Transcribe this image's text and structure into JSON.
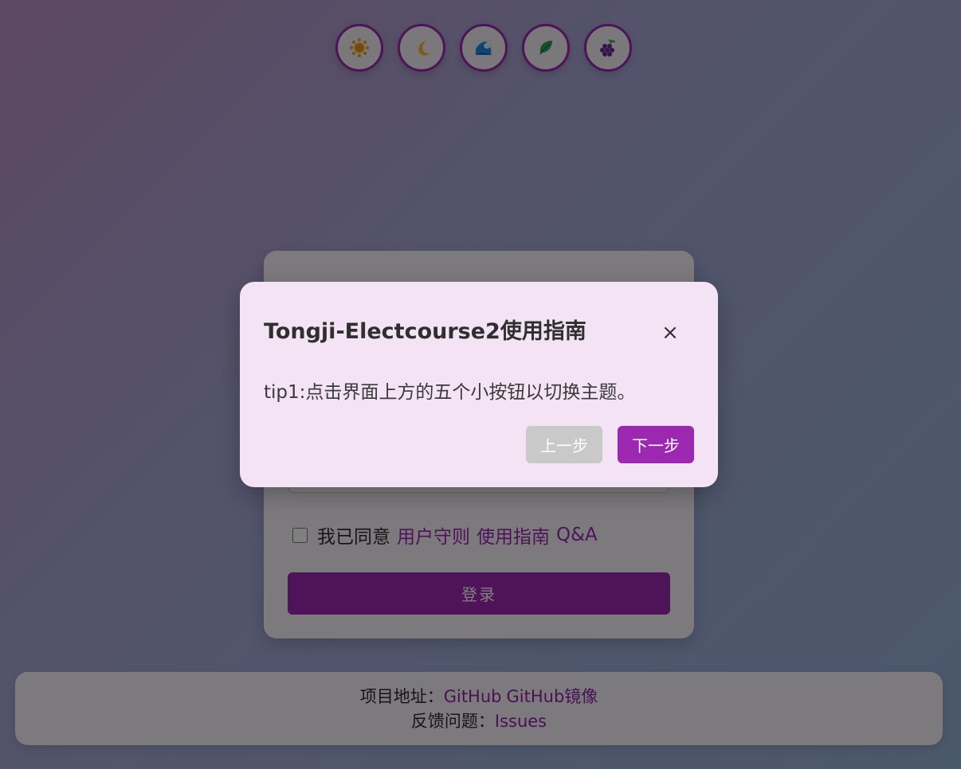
{
  "theme_buttons": [
    {
      "name": "sun-theme-button",
      "icon": "sun-icon"
    },
    {
      "name": "moon-theme-button",
      "icon": "moon-icon"
    },
    {
      "name": "wave-theme-button",
      "icon": "wave-icon"
    },
    {
      "name": "leaf-theme-button",
      "icon": "leaf-icon"
    },
    {
      "name": "grape-theme-button",
      "icon": "grape-icon"
    }
  ],
  "login": {
    "agree_label": "我已同意",
    "links": [
      "用户守则",
      "使用指南",
      "Q&A"
    ],
    "login_button": "登录"
  },
  "footer": {
    "project_label": "项目地址：",
    "project_links": [
      "GitHub",
      "GitHub镜像"
    ],
    "feedback_label": "反馈问题：",
    "feedback_link": "Issues"
  },
  "modal": {
    "title": "Tongji-Electcourse2使用指南",
    "close_symbol": "×",
    "body": "tip1:点击界面上方的五个小按钮以切换主题。",
    "prev_button": "上一步",
    "next_button": "下一步"
  },
  "colors": {
    "accent": "#9c27b0",
    "disabled": "#c9c9c9",
    "modal_bg": "#f3e3f5"
  }
}
